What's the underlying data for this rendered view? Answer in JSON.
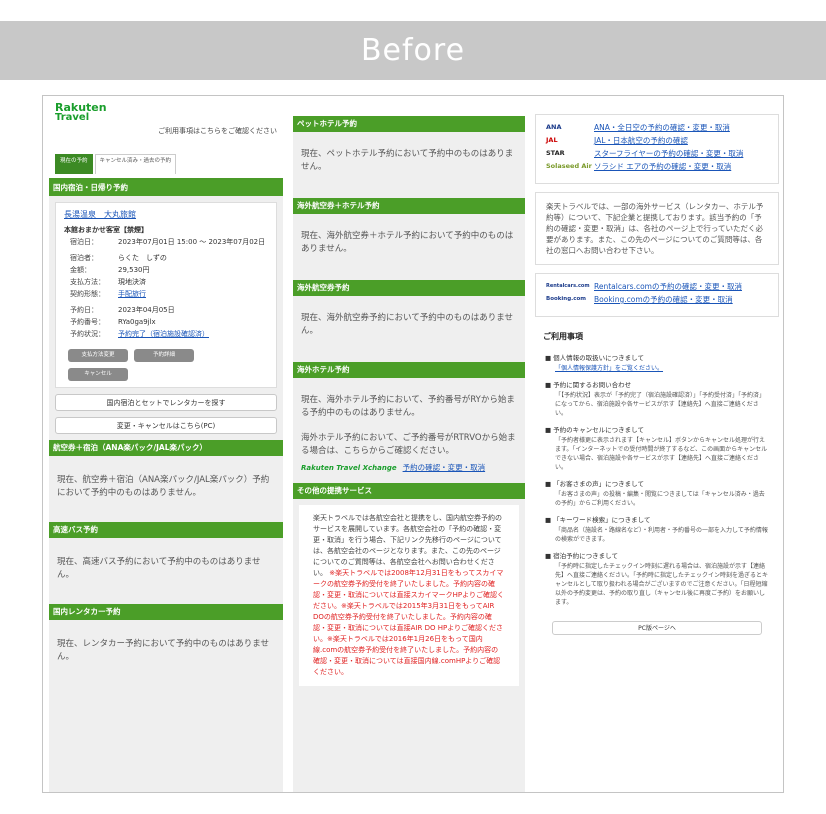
{
  "banner": "Before",
  "brand": {
    "line1": "Rakuten",
    "line2": "Travel",
    "note": "ご利用事項はこちらをご確認ください"
  },
  "tabs": [
    {
      "label": "現在の予約"
    },
    {
      "label": "キャンセル済み・過去の予約"
    }
  ],
  "domestic": {
    "header": "国内宿泊・日帰り予約",
    "hotel": "長湯温泉　大丸旅館",
    "room": "本館おまかせ客室【禁煙】",
    "fields": [
      {
        "k": "宿泊日：",
        "v": "2023年07月01日 15:00 ～ 2023年07月02日"
      },
      {
        "k": "宿泊者：",
        "v": "らくた　しずの"
      },
      {
        "k": "金額：",
        "v": "29,530円"
      },
      {
        "k": "支払方法：",
        "v": "現地決済"
      },
      {
        "k": "契約形態：",
        "v": "手配旅行",
        "link": true
      },
      {
        "k": "予約日：",
        "v": "2023年04月05日"
      },
      {
        "k": "予約番号：",
        "v": "RYa0ga9jlx"
      },
      {
        "k": "予約状況：",
        "v": "予約完了（宿泊施設確認済）",
        "link": true
      }
    ],
    "btn_pay": "支払方法変更",
    "btn_detail": "予約詳細",
    "btn_cancel": "キャンセル",
    "btn_rental": "国内宿泊とセットでレンタカーを探す",
    "btn_change": "変更・キャンセルはこちら(PC)"
  },
  "ana": {
    "header": "航空券＋宿泊（ANA楽パック/JAL楽パック）",
    "text": "現在、航空券＋宿泊（ANA楽パック/JAL楽パック）予約において予約中のものはありません。"
  },
  "bus": {
    "header": "高速バス予約",
    "text": "現在、高速バス予約において予約中のものはありません。"
  },
  "rentacar": {
    "header": "国内レンタカー予約",
    "text": "現在、レンタカー予約において予約中のものはありません。"
  },
  "pet": {
    "header": "ペットホテル予約",
    "text": "現在、ペットホテル予約において予約中のものはありません。"
  },
  "overseas_air_hotel": {
    "header": "海外航空券＋ホテル予約",
    "text": "現在、海外航空券＋ホテル予約において予約中のものはありません。"
  },
  "overseas_air": {
    "header": "海外航空券予約",
    "text": "現在、海外航空券予約において予約中のものはありません。"
  },
  "overseas_hotel": {
    "header": "海外ホテル予約",
    "text1": "現在、海外ホテル予約において、予約番号がRYから始まる予約中のものはありません。",
    "text2": "海外ホテル予約において、ご予約番号がRTRVOから始まる場合は、こちらからご確認ください。",
    "brand": "Rakuten Travel Xchange",
    "link": "予約の確認・変更・取消"
  },
  "other": {
    "header": "その他の提携サービス",
    "text": "楽天トラベルでは各航空会社と提携をし、国内航空券予約のサービスを展開しています。各航空会社の「予約の確認・変更・取消」を行う場合、下記リンク先移行のページについては、各航空会社のページとなります。また、この先のページについてのご質問等は、各航空会社へお問い合わせください。",
    "red": "※楽天トラベルでは2008年12月31日をもってスカイマークの航空券予約受付を終了いたしました。予約内容の確認・変更・取消については直接スカイマークHPよりご確認ください。※楽天トラベルでは2015年3月31日をもってAIR DOの航空券予約受付を終了いたしました。予約内容の確認・変更・取消については直接AIR DO HPよりご確認ください。※楽天トラベルでは2016年1月26日をもって国内線.comの航空券予約受付を終了いたしました。予約内容の確認・変更・取消については直接国内線.comHPよりご確認ください。"
  },
  "airlines": [
    {
      "logo": "ANA",
      "label": "ANA・全日空の予約の確認・変更・取消"
    },
    {
      "logo": "JAL",
      "label": "JAL・日本航空の予約の確認"
    },
    {
      "logo": "STAR",
      "label": "スターフライヤーの予約の確認・変更・取消"
    },
    {
      "logo": "Solaseed Air",
      "label": "ソラシド エアの予約の確認・変更・取消"
    }
  ],
  "overseas_note": "楽天トラベルでは、一部の海外サービス（レンタカー、ホテル予約等）について、下記企業と提携しております。該当予約の「予約の確認・変更・取消」は、各社のページ上で行っていただく必要があります。また、この先のページについてのご質問等は、各社の窓口へお問い合わせ下さい。",
  "partners": [
    {
      "logo": "Rentalcars.com",
      "label": "Rentalcars.comの予約の確認・変更・取消"
    },
    {
      "logo": "Booking.com",
      "label": "Booking.comの予約の確認・変更・取消"
    }
  ],
  "notes": {
    "title": "ご利用事項",
    "items": [
      {
        "h": "個人情報の取扱いにつきまして",
        "b": "「個人情報保護方針」をご覧ください。"
      },
      {
        "h": "予約に関するお問い合わせ",
        "b": "「【予約状況】表示が「予約完了（宿泊施設確認済）」「予約受付済」「予約済」になってから、宿泊施設や各サービスが示す【連絡先】へ直接ご連絡ください。"
      },
      {
        "h": "予約のキャンセルにつきまして",
        "b": "「予約者様更に表示されます【キャンセル】ボタンからキャンセル処理が行えます。「インターネットでの受付時間が終了するなど、この画面からキャンセルできない場合、宿泊施設や各サービスが示す【連絡先】へ直接ご連絡ください。"
      },
      {
        "h": "「お客さまの声」につきまして",
        "b": "「お客さまの声」の投稿・編集・閲覧につきましては「キャンセル済み・過去の予約」からご利用ください。"
      },
      {
        "h": "「キーワード検索」につきまして",
        "b": "「商品名（施設名・路線名など）・利用者・予約番号の一部を入力して予約情報の検索ができます。"
      },
      {
        "h": "宿泊予約につきまして",
        "b": "「予約時に指定したチェックイン時刻に遅れる場合は、宿泊施設が示す【連絡先】へ直接ご連絡ください。「予約時に指定したチェックイン時刻を過ぎるとキャンセルとして取り扱われる場合がございますのでご注意ください。「日程短縮以外の予約変更は、予約の取り直し（キャンセル後に再度ご予約）をお願いします。"
      }
    ],
    "pc": "PC版ページへ"
  }
}
